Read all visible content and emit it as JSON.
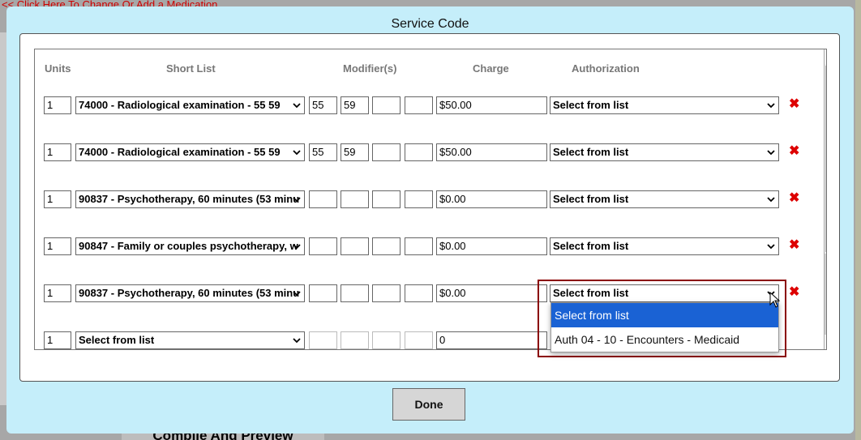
{
  "background": {
    "top_link": "<< Click Here To Change Or Add a Medication",
    "bottom_button": "Compile And Preview"
  },
  "modal": {
    "title": "Service Code",
    "headers": {
      "units": "Units",
      "short_list": "Short List",
      "modifiers": "Modifier(s)",
      "charge": "Charge",
      "authorization": "Authorization"
    },
    "rows": [
      {
        "units": "1",
        "code": "74000 - Radiological examination - 55 59",
        "mod1": "55",
        "mod2": "59",
        "mod3": "",
        "mod4": "",
        "charge": "$50.00",
        "auth": "Select from list"
      },
      {
        "units": "1",
        "code": "74000 - Radiological examination - 55 59",
        "mod1": "55",
        "mod2": "59",
        "mod3": "",
        "mod4": "",
        "charge": "$50.00",
        "auth": "Select from list"
      },
      {
        "units": "1",
        "code": "90837 - Psychotherapy, 60 minutes (53 minu",
        "mod1": "",
        "mod2": "",
        "mod3": "",
        "mod4": "",
        "charge": "$0.00",
        "auth": "Select from list"
      },
      {
        "units": "1",
        "code": "90847 - Family or couples psychotherapy, w",
        "mod1": "",
        "mod2": "",
        "mod3": "",
        "mod4": "",
        "charge": "$0.00",
        "auth": "Select from list"
      },
      {
        "units": "1",
        "code": "90837 - Psychotherapy, 60 minutes (53 minu",
        "mod1": "",
        "mod2": "",
        "mod3": "",
        "mod4": "",
        "charge": "$0.00",
        "auth": "Select from list"
      },
      {
        "units": "1",
        "code": "Select from list",
        "mod1": "",
        "mod2": "",
        "mod3": "",
        "mod4": "",
        "charge": "0",
        "auth": ""
      }
    ],
    "delete_symbol": "✖",
    "dropdown_options": [
      "Select from list",
      "Auth 04 - 10 - Encounters - Medicaid"
    ],
    "done_label": "Done"
  },
  "colors": {
    "modal_bg": "#c5eefa",
    "selected_option": "#1a62d4",
    "highlight_border": "#8b0000",
    "delete": "#dd0000"
  }
}
